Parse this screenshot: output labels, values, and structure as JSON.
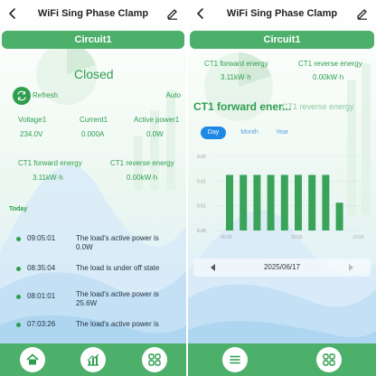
{
  "left": {
    "title": "WiFi Sing Phase Clamp",
    "circuit": "Circuit1",
    "status": "Closed",
    "refresh_label": "Refresh",
    "auto_label": "Auto",
    "metrics": [
      {
        "label": "Voltage1",
        "value": "234.0V"
      },
      {
        "label": "Current1",
        "value": "0.000A"
      },
      {
        "label": "Active power1",
        "value": "0.0W"
      }
    ],
    "energy": [
      {
        "label": "CT1 forward energy",
        "value": "3.11kW·h"
      },
      {
        "label": "CT1 reverse energy",
        "value": "0.00kW·h"
      }
    ],
    "today_label": "Today",
    "logs": [
      {
        "time": "09:05:01",
        "text": "The load's active power is 0.0W"
      },
      {
        "time": "08:35:04",
        "text": "The load is under off state"
      },
      {
        "time": "08:01:01",
        "text": "The load's active power is 25.6W"
      },
      {
        "time": "07:03:26",
        "text": "The load's active power is"
      }
    ],
    "nav": [
      "home-icon",
      "chart-icon",
      "grid-icon"
    ]
  },
  "right": {
    "title": "WiFi Sing Phase Clamp",
    "circuit": "Circuit1",
    "energy": [
      {
        "label": "CT1 forward energy",
        "value": "3.11kW·h"
      },
      {
        "label": "CT1 reverse energy",
        "value": "0.00kW·h"
      }
    ],
    "big_title": "CT1 forward ener...",
    "big_sub": "CT1 reverse energy",
    "tabs": [
      "Day",
      "Month",
      "Year"
    ],
    "active_tab": "Day",
    "date": "2025/06/17",
    "nav": [
      "menu-icon",
      "grid-icon"
    ],
    "accent": "#2e9e4f"
  },
  "chart_data": {
    "type": "bar",
    "y_tick_labels": [
      "0.02",
      "0.01",
      "0.01",
      "0.00"
    ],
    "x_tick_labels": [
      "00:00",
      "00:00",
      "10:00"
    ],
    "values": [
      0.015,
      0.015,
      0.015,
      0.015,
      0.015,
      0.015,
      0.015,
      0.015,
      0.0075
    ],
    "ylim": [
      0,
      0.02
    ],
    "grid": true,
    "legend": "none",
    "color": "#3aa35a"
  }
}
